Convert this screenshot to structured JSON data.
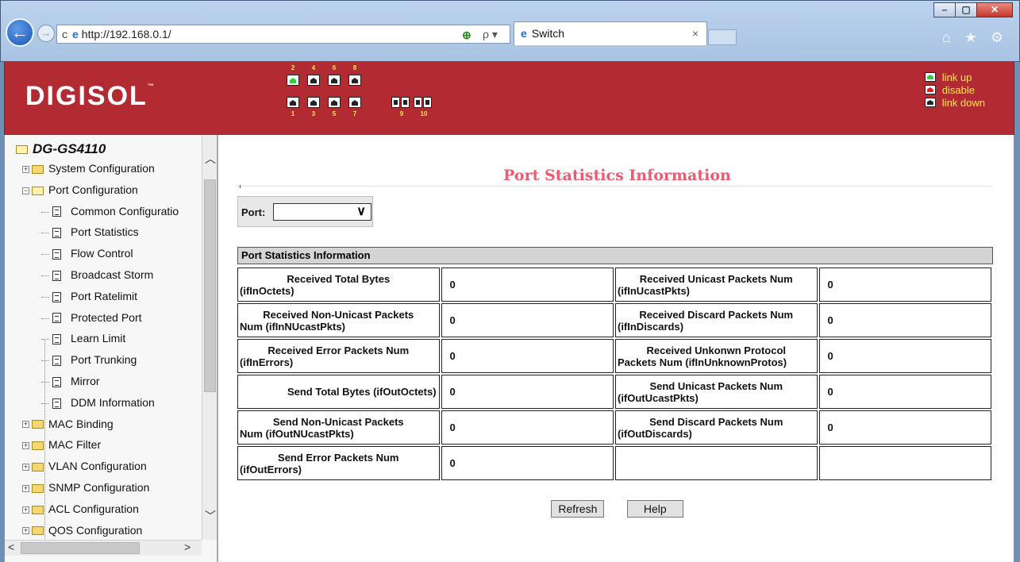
{
  "browser": {
    "url": "http://192.168.0.1/",
    "tab_title": "Switch",
    "tab_close": "×",
    "back": "←",
    "forward": "→",
    "refresh": "c",
    "search": "ρ ▾",
    "tools": "⌂ ★ ⚙",
    "window_buttons": [
      "–",
      "▢",
      "✕"
    ]
  },
  "header": {
    "logo": "DIGISOL",
    "logo_tm": "™",
    "ports_top": [
      {
        "num": "2",
        "state": "up"
      },
      {
        "num": "4",
        "state": "down"
      },
      {
        "num": "6",
        "state": "down"
      },
      {
        "num": "8",
        "state": "down"
      }
    ],
    "ports_bottom": [
      {
        "num": "1",
        "state": "down"
      },
      {
        "num": "3",
        "state": "down"
      },
      {
        "num": "5",
        "state": "down"
      },
      {
        "num": "7",
        "state": "down"
      }
    ],
    "sfp_ports": [
      "9",
      "10"
    ],
    "legend": {
      "up": "link up",
      "disable": "disable",
      "down": "link down"
    },
    "colors": {
      "banner": "#b22a32",
      "legend_text": "#ffe94a",
      "link_up": "#2ecc40",
      "disable": "#e51b1b"
    }
  },
  "nav": {
    "root": "DG-GS4110",
    "items": [
      {
        "label": "System Configuration",
        "type": "folder"
      },
      {
        "label": "Port Configuration",
        "type": "folder-open"
      },
      {
        "label": "Common Configuratio",
        "type": "page"
      },
      {
        "label": "Port Statistics",
        "type": "page"
      },
      {
        "label": "Flow Control",
        "type": "page"
      },
      {
        "label": "Broadcast Storm",
        "type": "page"
      },
      {
        "label": "Port Ratelimit",
        "type": "page"
      },
      {
        "label": "Protected Port",
        "type": "page"
      },
      {
        "label": "Learn Limit",
        "type": "page"
      },
      {
        "label": "Port Trunking",
        "type": "page"
      },
      {
        "label": "Mirror",
        "type": "page"
      },
      {
        "label": "DDM Information",
        "type": "page"
      },
      {
        "label": "MAC Binding",
        "type": "folder"
      },
      {
        "label": "MAC Filter",
        "type": "folder"
      },
      {
        "label": "VLAN Configuration",
        "type": "folder"
      },
      {
        "label": "SNMP Configuration",
        "type": "folder"
      },
      {
        "label": "ACL Configuration",
        "type": "folder"
      },
      {
        "label": "QOS Configuration",
        "type": "folder"
      }
    ]
  },
  "main": {
    "title": "Port Statistics Information",
    "port_label": "Port:",
    "port_value": "",
    "section_header": "Port Statistics Information",
    "rows": [
      {
        "left_l1": "Received Total Bytes",
        "left_l2": "(ifInOctets)",
        "left_val": "0",
        "right_l1": "Received Unicast Packets Num",
        "right_l2": "(ifInUcastPkts)",
        "right_val": "0"
      },
      {
        "left_l1": "Received Non-Unicast Packets",
        "left_l2": "Num (ifInNUcastPkts)",
        "left_val": "0",
        "right_l1": "Received Discard Packets Num",
        "right_l2": "(ifInDiscards)",
        "right_val": "0"
      },
      {
        "left_l1": "Received Error Packets Num",
        "left_l2": "(ifInErrors)",
        "left_val": "0",
        "right_l1": "Received Unkonwn Protocol",
        "right_l2": "Packets Num (ifInUnknownProtos)",
        "right_val": "0"
      },
      {
        "left_l1": "Send Total Bytes (ifOutOctets)",
        "left_l2": "",
        "left_val": "0",
        "right_l1": "Send Unicast Packets Num",
        "right_l2": "(ifOutUcastPkts)",
        "right_val": "0"
      },
      {
        "left_l1": "Send Non-Unicast Packets",
        "left_l2": "Num (ifOutNUcastPkts)",
        "left_val": "0",
        "right_l1": "Send Discard Packets Num",
        "right_l2": "(ifOutDiscards)",
        "right_val": "0"
      },
      {
        "left_l1": "Send Error Packets Num",
        "left_l2": "(ifOutErrors)",
        "left_val": "0",
        "right_l1": "",
        "right_l2": "",
        "right_val": ""
      }
    ],
    "refresh_label": "Refresh",
    "help_label": "Help"
  }
}
